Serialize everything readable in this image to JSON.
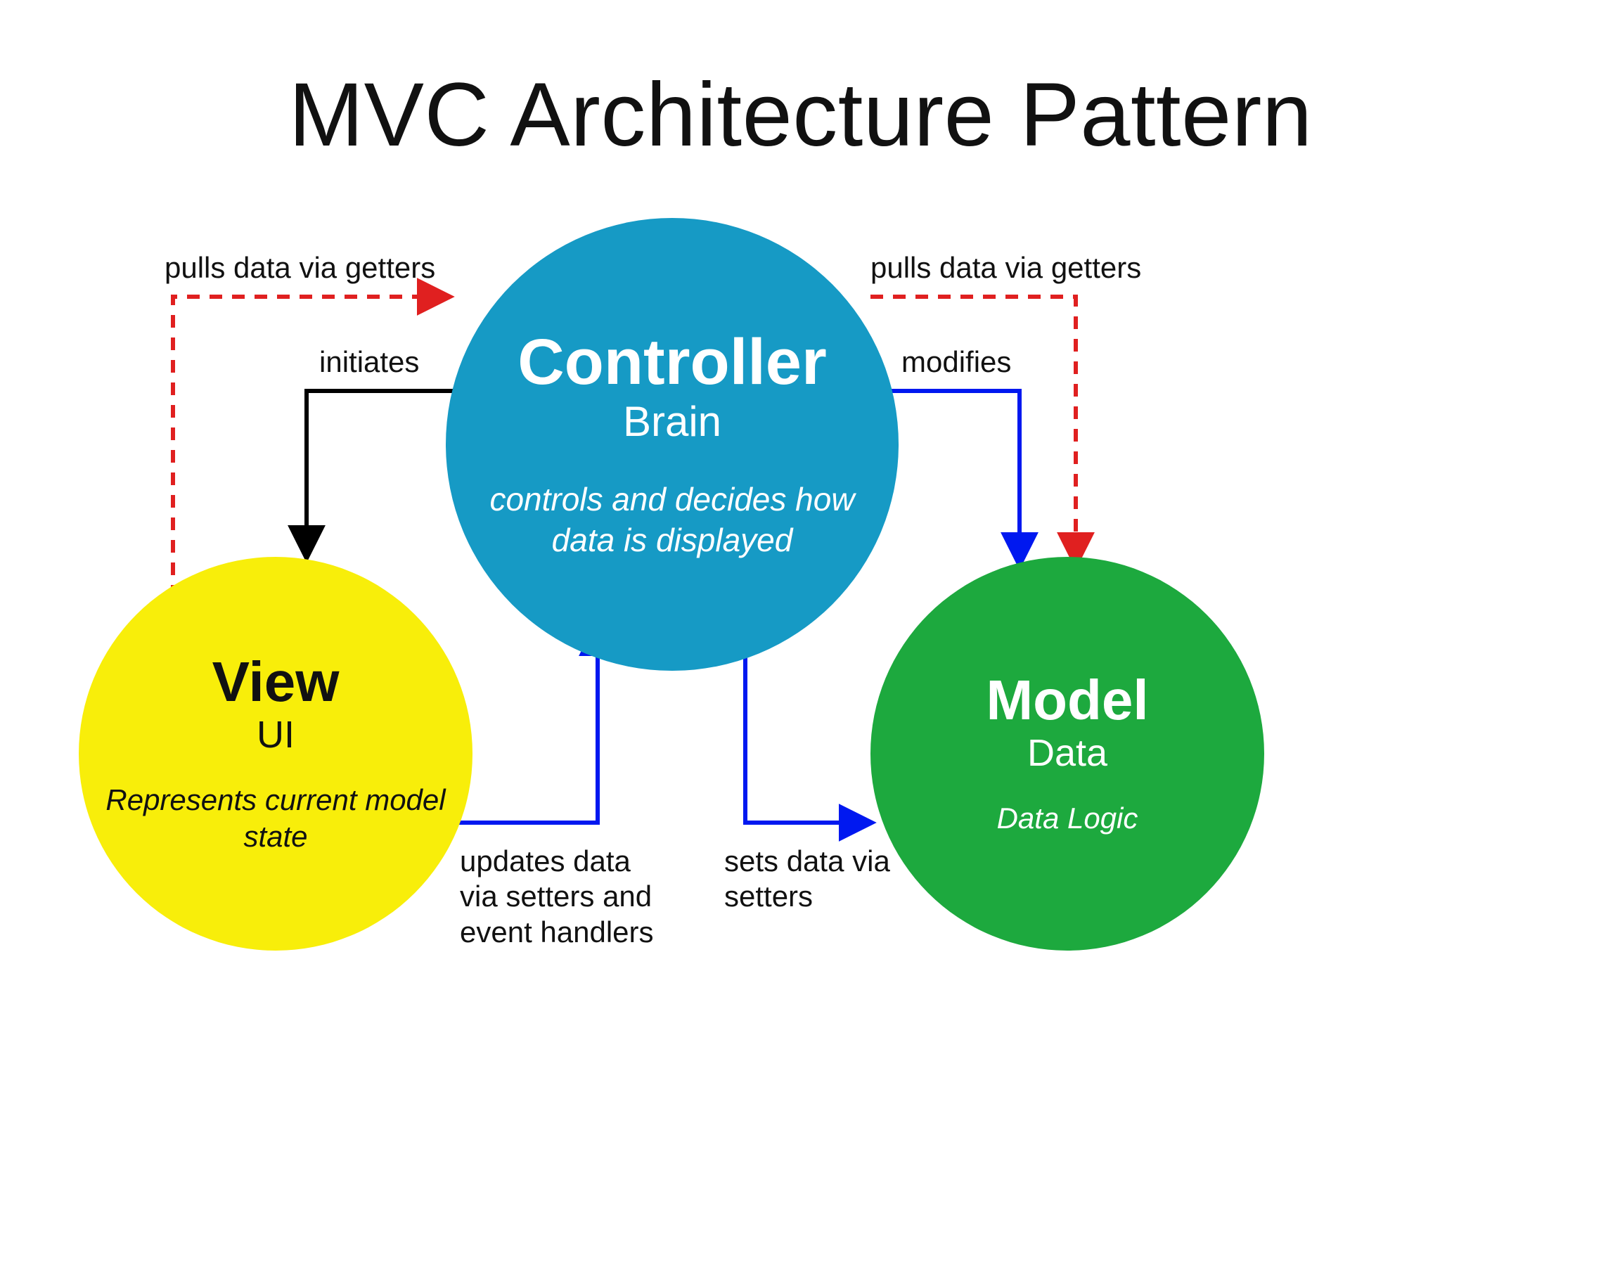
{
  "title": "MVC Architecture Pattern",
  "nodes": {
    "controller": {
      "name": "Controller",
      "sub": "Brain",
      "desc": "controls and decides how data is displayed",
      "color": "#169ac5",
      "text_color": "#ffffff"
    },
    "view": {
      "name": "View",
      "sub": "UI",
      "desc": "Represents current model state",
      "color": "#f8ee0a",
      "text_color": "#111111"
    },
    "model": {
      "name": "Model",
      "sub": "Data",
      "desc": "Data Logic",
      "color": "#1da93e",
      "text_color": "#ffffff"
    }
  },
  "edges": {
    "view_pulls_from_controller": {
      "label": "pulls data via getters",
      "from": "view",
      "to": "controller",
      "style": "dashed",
      "color": "#e02020"
    },
    "controller_pulls_from_model": {
      "label": "pulls data via getters",
      "from": "controller",
      "to": "model",
      "style": "dashed",
      "color": "#e02020"
    },
    "controller_initiates_view": {
      "label": "initiates",
      "from": "controller",
      "to": "view",
      "style": "solid",
      "color": "#000000"
    },
    "controller_modifies_model": {
      "label": "modifies",
      "from": "controller",
      "to": "model",
      "style": "solid",
      "color": "#0018f0"
    },
    "view_updates_controller": {
      "label": "updates data via setters and event handlers",
      "from": "view",
      "to": "controller",
      "style": "solid",
      "color": "#0018f0"
    },
    "controller_sets_model": {
      "label": "sets data via setters",
      "from": "controller",
      "to": "model",
      "style": "solid",
      "color": "#0018f0"
    }
  }
}
